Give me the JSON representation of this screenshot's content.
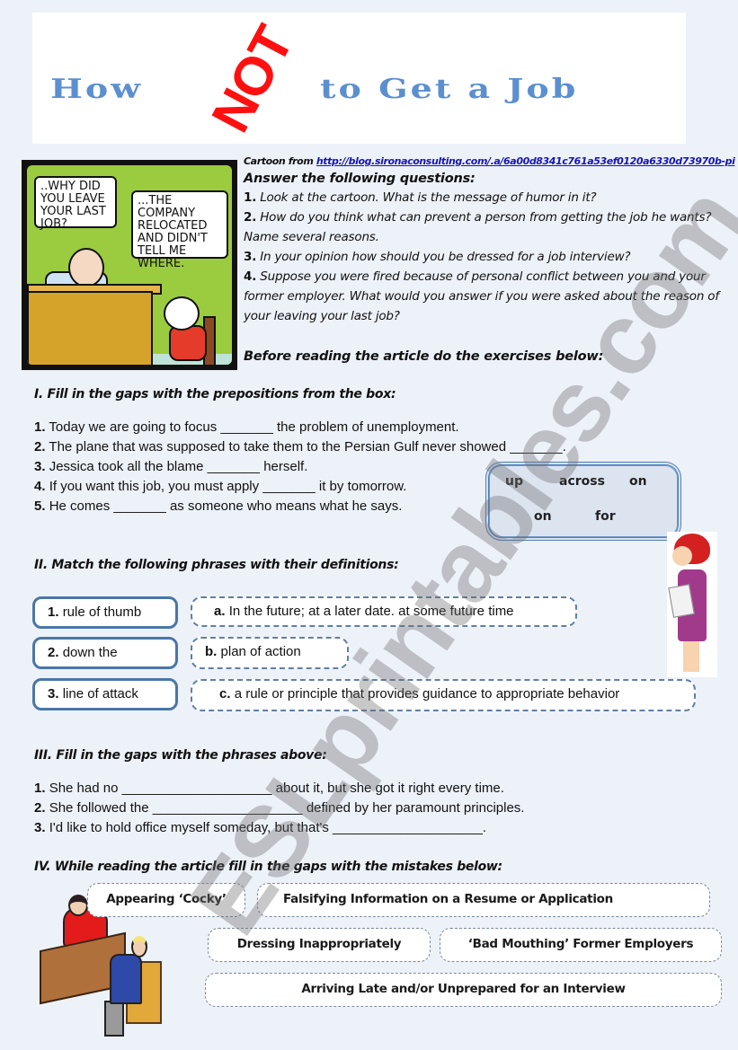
{
  "title": {
    "part1": "How",
    "emphasis": "NOT",
    "part2": "to Get a Job",
    "title_color": "#5b8fd0",
    "emphasis_color": "#ff1010"
  },
  "cartoon": {
    "bubble_left": "..WHY DID YOU LEAVE YOUR LAST JOB?",
    "bubble_right": "...THE COMPANY RELOCATED AND DIDN'T TELL ME WHERE."
  },
  "source": {
    "label": "Cartoon from",
    "link": "http://blog.sironaconsulting.com/.a/6a00d8341c761a53ef0120a6330d73970b-pi"
  },
  "questions": {
    "heading": "Answer the following questions:",
    "items": [
      {
        "num": "1.",
        "text": "Look at the cartoon. What is the message of humor in it?"
      },
      {
        "num": "2.",
        "text": "How do you think what can prevent a person from getting the job he wants? Name several reasons."
      },
      {
        "num": "3.",
        "text": "In your opinion how should you be dressed for a job interview?"
      },
      {
        "num": "4.",
        "text": "Suppose you were fired because of personal conflict between you and your former employer. What would you answer if you were asked about the reason of your leaving your last job?"
      }
    ],
    "before_reading": "Before reading the article do the exercises below:"
  },
  "section1": {
    "heading": "I. Fill in the gaps with the prepositions from the box:",
    "items": [
      {
        "num": "1.",
        "before": "Today we are going to focus",
        "blank": "_______",
        "after": "the problem of unemployment."
      },
      {
        "num": "2.",
        "before": "The plane that was supposed to take them to the Persian Gulf never showed",
        "blank": "_______",
        "after": "."
      },
      {
        "num": "3.",
        "before": "Jessica took all the blame",
        "blank": "_______",
        "after": "herself."
      },
      {
        "num": "4.",
        "before": "If you want this job, you must apply",
        "blank": "_______",
        "after": "it by tomorrow."
      },
      {
        "num": "5.",
        "before": "He comes",
        "blank": "_______",
        "after": "as someone who means what he says."
      }
    ],
    "box_words": [
      "up",
      "across",
      "on",
      "on",
      "for"
    ]
  },
  "section2": {
    "heading": "II. Match the following phrases with their definitions:",
    "phrases": [
      {
        "num": "1.",
        "text": "rule of thumb"
      },
      {
        "num": "2.",
        "text": "down the"
      },
      {
        "num": "3.",
        "text": "line of attack"
      }
    ],
    "definitions": [
      {
        "letter": "a.",
        "text": "In the future; at a later date. at some future time"
      },
      {
        "letter": "b.",
        "text": "plan of action"
      },
      {
        "letter": "c.",
        "text": "a rule or principle that provides guidance to appropriate behavior"
      }
    ]
  },
  "section3": {
    "heading": "III. Fill in the gaps with the phrases above:",
    "items": [
      {
        "num": "1.",
        "before": "She had no",
        "blank": "____________________",
        "after": "about it, but she got it right every time."
      },
      {
        "num": "2.",
        "before": "She followed the",
        "blank": "____________________",
        "after": "defined by her paramount principles."
      },
      {
        "num": "3.",
        "before": "I'd like to hold office myself someday, but that's",
        "blank": "____________________",
        "after": "."
      }
    ]
  },
  "section4": {
    "heading": "IV. While reading the article fill in the gaps with the mistakes below:",
    "mistakes": [
      "Appearing ‘Cocky’",
      "Falsifying Information on a Resume or Application",
      "Dressing Inappropriately",
      "‘Bad Mouthing’ Former Employers",
      "Arriving Late and/or Unprepared for an Interview"
    ]
  },
  "watermark": "ESLprintables.com"
}
